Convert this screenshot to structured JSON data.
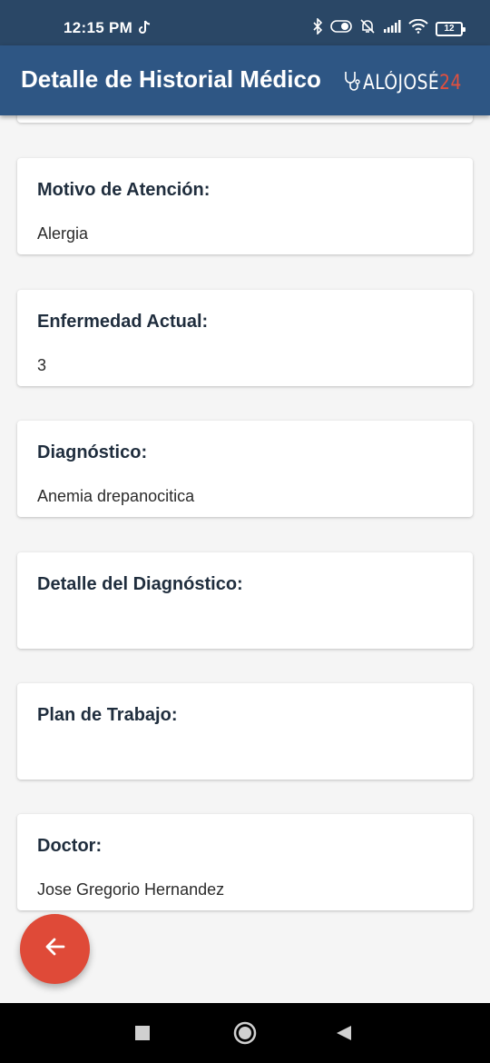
{
  "status_bar": {
    "time": "12:15 PM",
    "battery": "12"
  },
  "app_bar": {
    "title": "Detalle de Historial Médico",
    "logo_text": "ALÓJOSÉ",
    "logo_number": "24"
  },
  "fields": [
    {
      "label": "Motivo de Atención:",
      "value": "Alergia"
    },
    {
      "label": "Enfermedad Actual:",
      "value": "3"
    },
    {
      "label": "Diagnóstico:",
      "value": "Anemia drepanocitica"
    },
    {
      "label": "Detalle del Diagnóstico:",
      "value": ""
    },
    {
      "label": "Plan de Trabajo:",
      "value": ""
    },
    {
      "label": "Doctor:",
      "value": "Jose Gregorio Hernandez"
    }
  ],
  "icons": {
    "back_fab": "arrow-left-icon",
    "nav_recents": "square-icon",
    "nav_home": "circle-icon",
    "nav_back": "triangle-back-icon"
  },
  "colors": {
    "app_bar": "#2e5684",
    "status_bar": "#2a4766",
    "fab": "#df4a38",
    "logo_accent": "#e0503f"
  }
}
